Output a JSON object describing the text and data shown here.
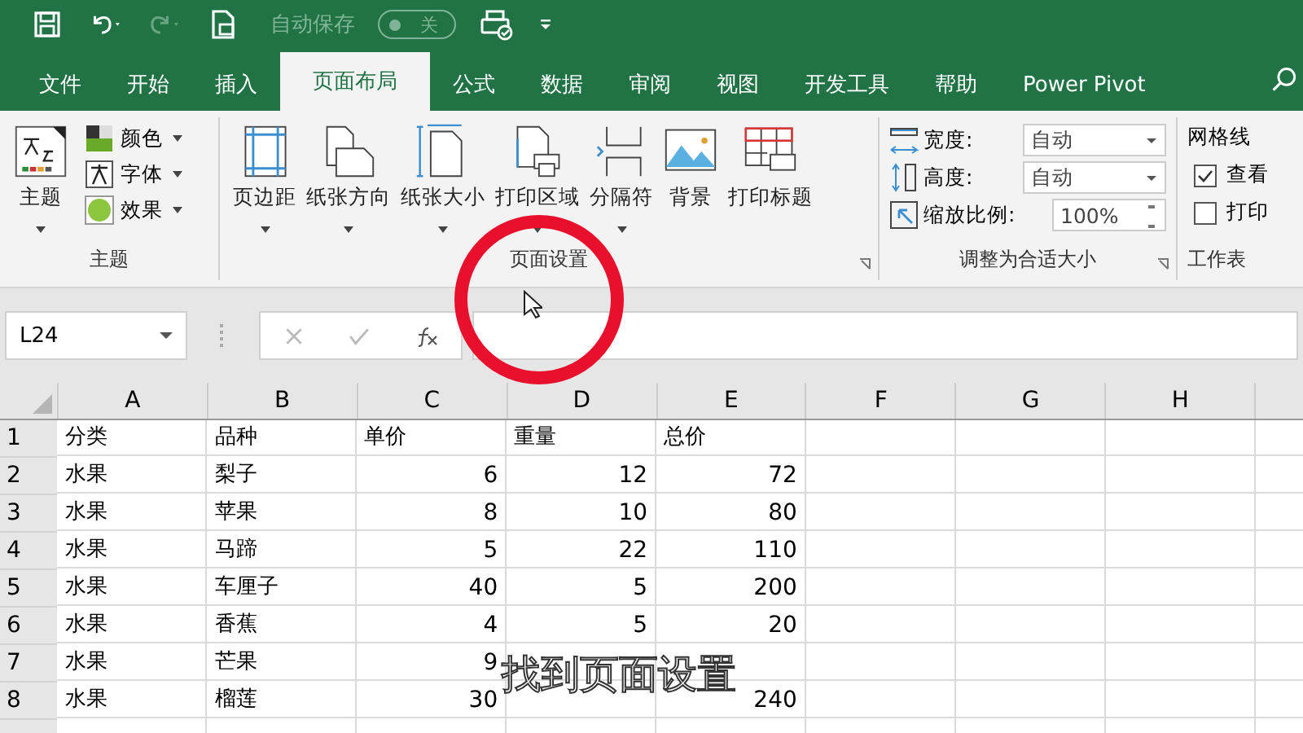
{
  "quick_access": {
    "autosave_label": "自动保存",
    "autosave_toggle": {
      "label": "关",
      "on": false
    }
  },
  "tabs": [
    {
      "label": "文件",
      "selected": false
    },
    {
      "label": "开始",
      "selected": false
    },
    {
      "label": "插入",
      "selected": false
    },
    {
      "label": "页面布局",
      "selected": true
    },
    {
      "label": "公式",
      "selected": false
    },
    {
      "label": "数据",
      "selected": false
    },
    {
      "label": "审阅",
      "selected": false
    },
    {
      "label": "视图",
      "selected": false
    },
    {
      "label": "开发工具",
      "selected": false
    },
    {
      "label": "帮助",
      "selected": false
    },
    {
      "label": "Power Pivot",
      "selected": false
    }
  ],
  "ribbon": {
    "theme_group": {
      "label": "主题",
      "main": {
        "label": "主题",
        "dropdown": true
      },
      "items": [
        {
          "label": "颜色",
          "kind": "colors"
        },
        {
          "label": "字体",
          "kind": "fonts"
        },
        {
          "label": "效果",
          "kind": "effects"
        }
      ]
    },
    "page_setup_group": {
      "label": "页面设置",
      "buttons": [
        {
          "label": "页边距",
          "kind": "margins",
          "dropdown": true
        },
        {
          "label": "纸张方向",
          "kind": "orientation",
          "dropdown": true
        },
        {
          "label": "纸张大小",
          "kind": "size",
          "dropdown": true
        },
        {
          "label": "打印区域",
          "kind": "print-area",
          "dropdown": true
        },
        {
          "label": "分隔符",
          "kind": "breaks",
          "dropdown": true
        },
        {
          "label": "背景",
          "kind": "background",
          "dropdown": false
        },
        {
          "label": "打印标题",
          "kind": "print-titles",
          "dropdown": false
        }
      ]
    },
    "scale_group": {
      "label": "调整为合适大小",
      "rows": [
        {
          "label": "宽度:",
          "value": "自动",
          "kind": "width"
        },
        {
          "label": "高度:",
          "value": "自动",
          "kind": "height"
        },
        {
          "label": "缩放比例:",
          "value": "100%",
          "kind": "scale"
        }
      ]
    },
    "sheet_options_group": {
      "label": "工作表",
      "heading": "网格线",
      "options": [
        {
          "label": "查看",
          "checked": true
        },
        {
          "label": "打印",
          "checked": false
        }
      ]
    }
  },
  "name_box": "L24",
  "sheet": {
    "columns": [
      "A",
      "B",
      "C",
      "D",
      "E",
      "F",
      "G",
      "H"
    ],
    "rows": [
      {
        "number": "1",
        "cells": [
          "分类",
          "品种",
          "单价",
          "重量",
          "总价"
        ]
      },
      {
        "number": "2",
        "cells": [
          "水果",
          "梨子",
          "6",
          "12",
          "72"
        ]
      },
      {
        "number": "3",
        "cells": [
          "水果",
          "苹果",
          "8",
          "10",
          "80"
        ]
      },
      {
        "number": "4",
        "cells": [
          "水果",
          "马蹄",
          "5",
          "22",
          "110"
        ]
      },
      {
        "number": "5",
        "cells": [
          "水果",
          "车厘子",
          "40",
          "5",
          "200"
        ]
      },
      {
        "number": "6",
        "cells": [
          "水果",
          "香蕉",
          "4",
          "5",
          "20"
        ]
      },
      {
        "number": "7",
        "cells": [
          "水果",
          "芒果",
          "9",
          "",
          ""
        ]
      },
      {
        "number": "8",
        "cells": [
          "水果",
          "榴莲",
          "30",
          "",
          "240"
        ]
      }
    ]
  },
  "subtitle": "找到页面设置"
}
